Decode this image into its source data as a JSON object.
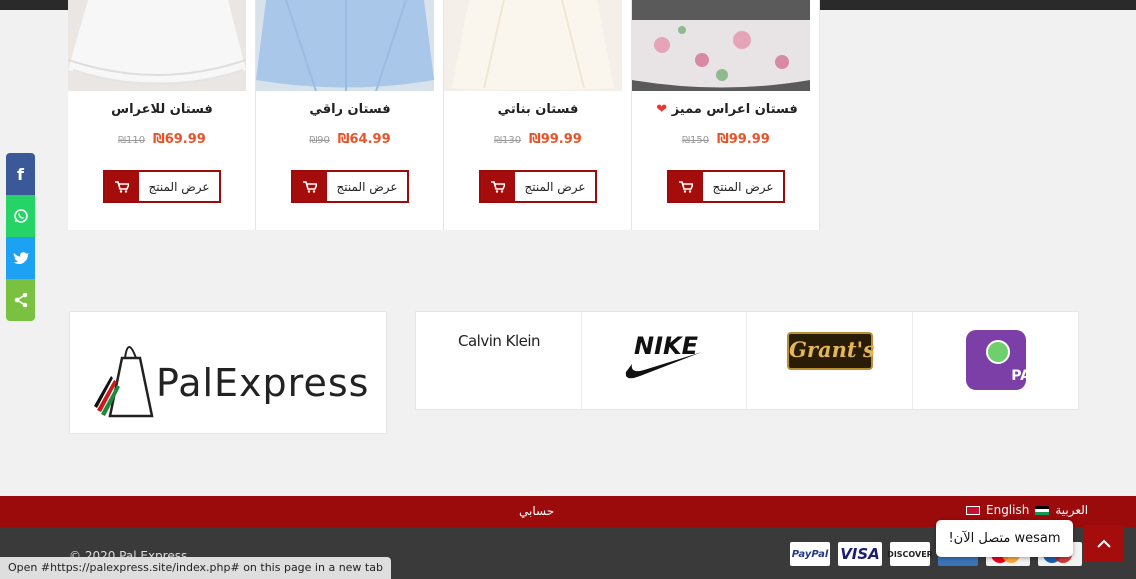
{
  "products": [
    {
      "title": "فستان للاعراس",
      "old_price": "₪110",
      "new_price": "₪69.99",
      "button": "عرض المنتج",
      "heart": ""
    },
    {
      "title": "فستان راقي",
      "old_price": "₪90",
      "new_price": "₪64.99",
      "button": "عرض المنتج",
      "heart": ""
    },
    {
      "title": "فستان بناتي",
      "old_price": "₪130",
      "new_price": "₪99.99",
      "button": "عرض المنتج",
      "heart": ""
    },
    {
      "title": "فستان اعراس مميز",
      "old_price": "₪150",
      "new_price": "₪99.99",
      "button": "عرض المنتج",
      "heart": "❤"
    }
  ],
  "social": {
    "facebook": "f",
    "whatsapp": "✆",
    "twitter": "🐦",
    "share": "<"
  },
  "logo": {
    "name": "PalExpress"
  },
  "brands": {
    "calvin_klein": "Calvin Klein",
    "nike": "NIKE",
    "grants": "Grant's",
    "pay": "PAY"
  },
  "footer": {
    "account": "حسابي",
    "lang_ar": "العربية",
    "lang_en": "English",
    "copyright": "© 2020 Pal Express",
    "payments": {
      "paypal": "PayPal",
      "visa": "VISA",
      "discover": "DISCOVER"
    }
  },
  "chat": {
    "text": "wesam متصل الآن!"
  },
  "status_bar": {
    "text": "Open #https://palexpress.site/index.php# on this page in a new tab"
  },
  "colors": {
    "accent_red": "#9b0b0b",
    "price_orange": "#e8542a"
  }
}
